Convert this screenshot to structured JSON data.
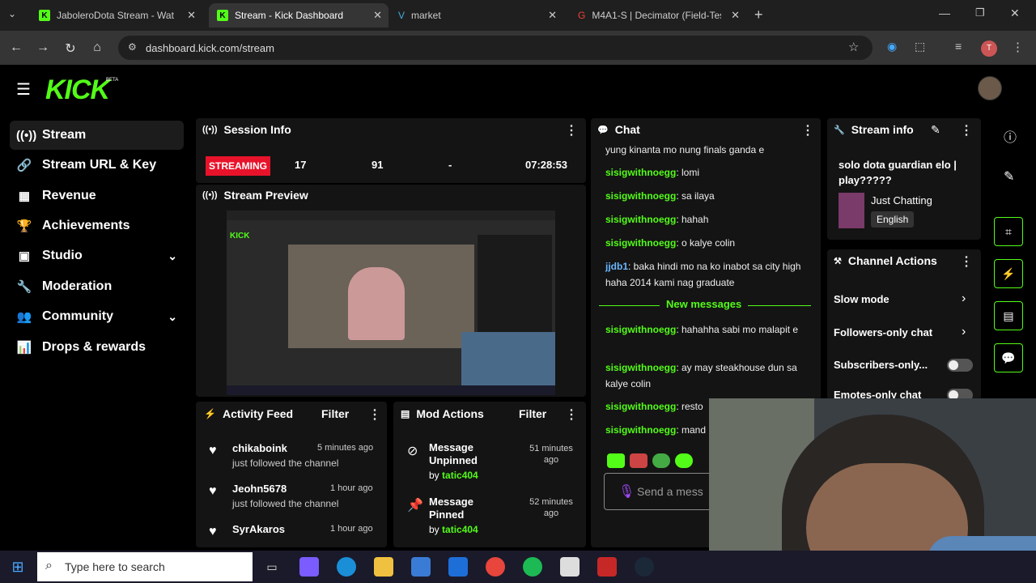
{
  "browser": {
    "tabs": [
      {
        "label": "JaboleroDota Stream - Wat"
      },
      {
        "label": "Stream - Kick Dashboard"
      },
      {
        "label": "market"
      },
      {
        "label": "M4A1-S | Decimator (Field-Test"
      }
    ],
    "url": "dashboard.kick.com/stream"
  },
  "brand": {
    "logo": "KICK",
    "beta": "BETA",
    "accent": "#53fc18"
  },
  "sidebar": {
    "items": [
      {
        "label": "Stream"
      },
      {
        "label": "Stream URL & Key"
      },
      {
        "label": "Revenue"
      },
      {
        "label": "Achievements"
      },
      {
        "label": "Studio"
      },
      {
        "label": "Moderation"
      },
      {
        "label": "Community"
      },
      {
        "label": "Drops & rewards"
      }
    ]
  },
  "session": {
    "title": "Session Info",
    "status": "STREAMING",
    "stat1": "17",
    "stat2": "91",
    "stat3": "-",
    "duration": "07:28:53"
  },
  "preview": {
    "title": "Stream Preview"
  },
  "activity": {
    "title": "Activity Feed",
    "filter": "Filter",
    "items": [
      {
        "name": "chikaboink",
        "time": "5 minutes ago",
        "sub": "just followed the channel"
      },
      {
        "name": "Jeohn5678",
        "time": "1 hour ago",
        "sub": "just followed the channel"
      },
      {
        "name": "SyrAkaros",
        "time": "1 hour ago",
        "sub": ""
      }
    ]
  },
  "mod": {
    "title": "Mod Actions",
    "filter": "Filter",
    "items": [
      {
        "action": "Message Unpinned",
        "time": "51 minutes ago",
        "by": "by",
        "user": "tatic404"
      },
      {
        "action": "Message Pinned",
        "time": "52 minutes ago",
        "by": "by",
        "user": "tatic404"
      }
    ]
  },
  "chat": {
    "title": "Chat",
    "new_messages": "New messages",
    "placeholder": "Send a mess",
    "messages": [
      {
        "user": "",
        "text": "yung kinanta mo nung finals ganda e"
      },
      {
        "user": "sisigwithnoegg",
        "text": ": lomi"
      },
      {
        "user": "sisigwithnoegg",
        "text": ": sa ilaya"
      },
      {
        "user": "sisigwithnoegg",
        "text": ": hahah"
      },
      {
        "user": "sisigwithnoegg",
        "text": ": o kalye colin"
      },
      {
        "user": "jjdb1",
        "text": ": baka hindi mo na ko inabot sa city high haha 2014 kami nag graduate"
      },
      {
        "user": "sisigwithnoegg",
        "text": ": hahahha sabi mo malapit e"
      },
      {
        "user": "sisigwithnoegg",
        "text": ": ay may steakhouse dun sa kalye colin"
      },
      {
        "user": "sisigwithnoegg",
        "text": ": resto"
      },
      {
        "user": "sisigwithnoegg",
        "text": ": mand"
      }
    ]
  },
  "stream_info": {
    "title": "Stream info",
    "stream_title": "solo dota guardian elo | play?????",
    "category": "Just Chatting",
    "language": "English"
  },
  "channel_actions": {
    "title": "Channel Actions",
    "items": [
      {
        "label": "Slow mode"
      },
      {
        "label": "Followers-only chat"
      },
      {
        "label": "Subscribers-only..."
      },
      {
        "label": "Emotes-only chat"
      }
    ]
  },
  "taskbar": {
    "search": "Type here to search"
  }
}
